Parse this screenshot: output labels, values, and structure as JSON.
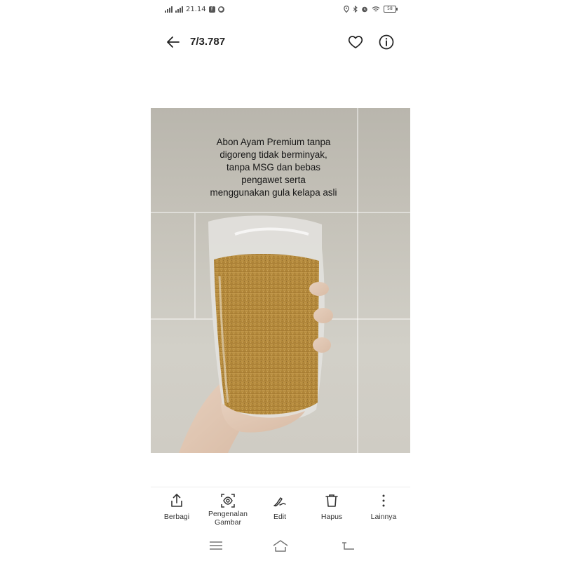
{
  "status_bar": {
    "time": "21.14",
    "left_icons": [
      "signal-icon",
      "signal-icon",
      "facebook-icon",
      "notification-icon"
    ],
    "right_icons": [
      "location-icon",
      "bluetooth-icon",
      "alarm-icon",
      "wifi-icon",
      "battery-icon"
    ],
    "battery": "58"
  },
  "header": {
    "counter": "7/3.787",
    "back_icon": "arrow-left-icon",
    "favorite_icon": "heart-icon",
    "info_icon": "info-icon"
  },
  "photo": {
    "caption_lines": [
      "Abon  Ayam Premium tanpa",
      "digoreng tidak berminyak,",
      "tanpa MSG dan bebas",
      "pengawet serta",
      "menggunakan gula kelapa asli"
    ]
  },
  "toolbar": {
    "share": {
      "label": "Berbagi",
      "icon": "share-icon"
    },
    "lens": {
      "label_line1": "Pengenalan",
      "label_line2": "Gambar",
      "icon": "image-recognition-icon"
    },
    "edit": {
      "label": "Edit",
      "icon": "pen-icon"
    },
    "delete": {
      "label": "Hapus",
      "icon": "trash-icon"
    },
    "more": {
      "label": "Lainnya",
      "icon": "more-vertical-icon"
    }
  },
  "navbar": {
    "icons": [
      "menu-icon",
      "home-icon",
      "back-icon"
    ]
  },
  "colors": {
    "icon": "#333333",
    "background": "#ffffff",
    "bag_fill": "#b08a3c"
  }
}
